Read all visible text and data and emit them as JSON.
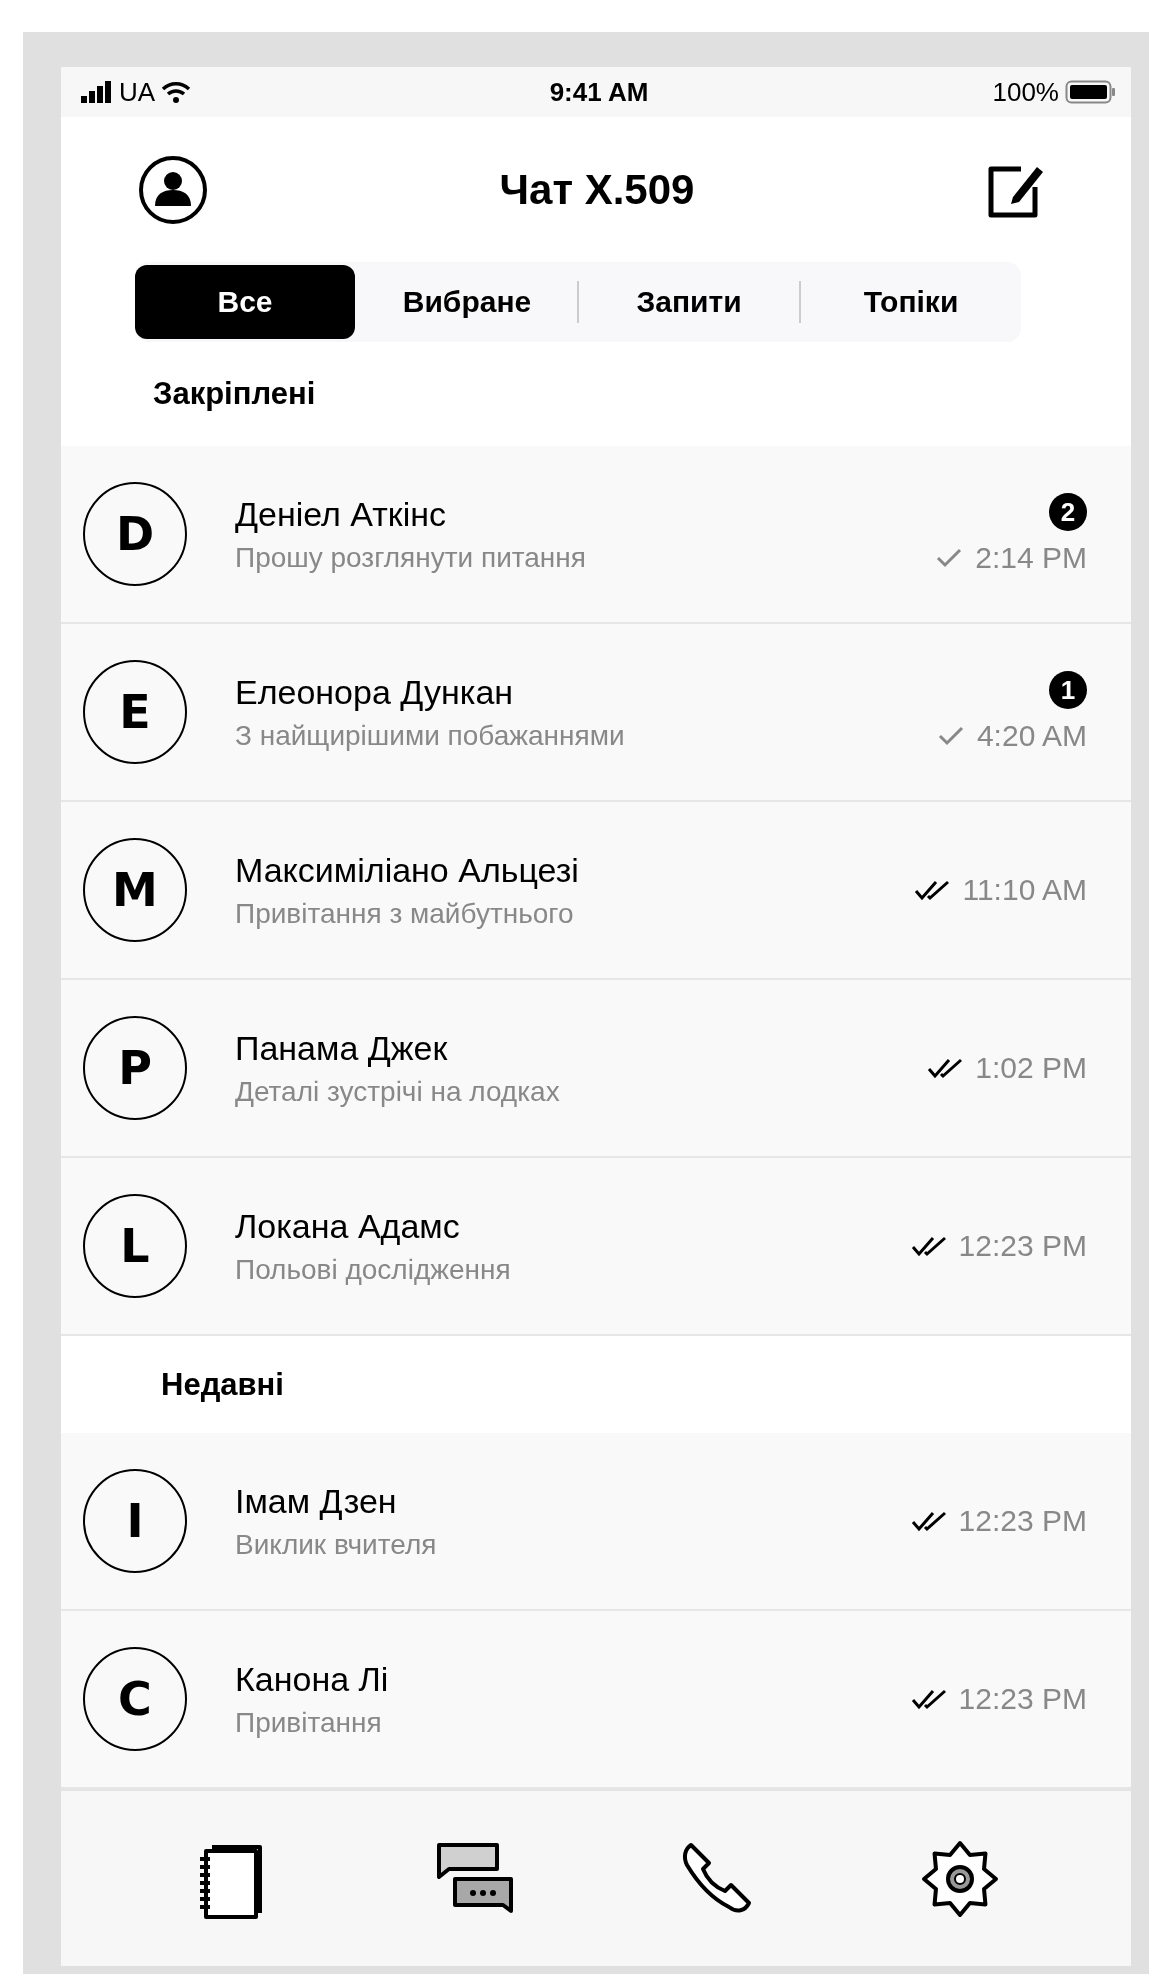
{
  "status_bar": {
    "carrier": "UA",
    "time": "9:41 AM",
    "battery": "100%"
  },
  "header": {
    "title": "Чат X.509"
  },
  "tabs": [
    {
      "label": "Все",
      "selected": true
    },
    {
      "label": "Вибране",
      "selected": false
    },
    {
      "label": "Запити",
      "selected": false
    },
    {
      "label": "Топіки",
      "selected": false
    }
  ],
  "sections": [
    {
      "title": "Закріплені",
      "chats": [
        {
          "initial": "D",
          "name": "Деніел Аткінс",
          "message": "Прошу розглянути питання",
          "time": "2:14 PM",
          "read": false,
          "badge": "2"
        },
        {
          "initial": "E",
          "name": "Елеонора Дункан",
          "message": "З найщирішими побажаннями",
          "time": "4:20 AM",
          "read": false,
          "badge": "1"
        },
        {
          "initial": "M",
          "name": "Максиміліано Альцезі",
          "message": "Привітання з майбутнього",
          "time": "11:10 AM",
          "read": true
        },
        {
          "initial": "P",
          "name": "Панама Джек",
          "message": "Деталі зустрічі на лодках",
          "time": "1:02 PM",
          "read": true
        },
        {
          "initial": "L",
          "name": "Локана Адамс",
          "message": "Польові дослідження",
          "time": "12:23 PM",
          "read": true
        }
      ]
    },
    {
      "title": "Недавні",
      "chats": [
        {
          "initial": "I",
          "name": "Імам Дзен",
          "message": "Виклик вчителя",
          "time": "12:23 PM",
          "read": true
        },
        {
          "initial": "C",
          "name": "Канона Лі",
          "message": "Привітання",
          "time": "12:23 PM",
          "read": true
        }
      ]
    }
  ],
  "nav": [
    {
      "kind": "notebook"
    },
    {
      "kind": "chats"
    },
    {
      "kind": "phone"
    },
    {
      "kind": "settings"
    }
  ]
}
